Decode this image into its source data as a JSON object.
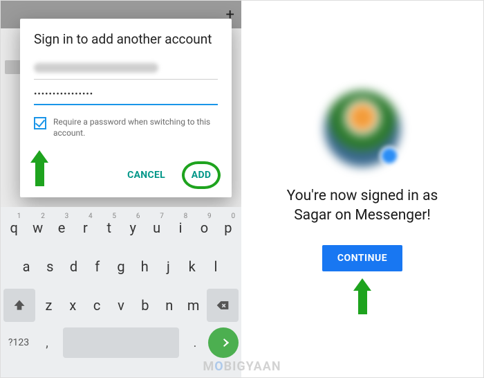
{
  "left": {
    "topbar": {
      "plus": "+"
    },
    "dialog": {
      "title": "Sign in to add another account",
      "password_dots": "••••••••••••••••",
      "checkbox_label": "Require a password when switching to this account.",
      "cancel": "CANCEL",
      "add": "ADD"
    },
    "keyboard": {
      "row1": [
        {
          "k": "q",
          "n": "1"
        },
        {
          "k": "w",
          "n": "2"
        },
        {
          "k": "e",
          "n": "3"
        },
        {
          "k": "r",
          "n": "4"
        },
        {
          "k": "t",
          "n": "5"
        },
        {
          "k": "y",
          "n": "6"
        },
        {
          "k": "u",
          "n": "7"
        },
        {
          "k": "i",
          "n": "8"
        },
        {
          "k": "o",
          "n": "9"
        },
        {
          "k": "p",
          "n": "0"
        }
      ],
      "row2": [
        "a",
        "s",
        "d",
        "f",
        "g",
        "h",
        "j",
        "k",
        "l"
      ],
      "row3": [
        "z",
        "x",
        "c",
        "v",
        "b",
        "n",
        "m"
      ],
      "sym": "?123",
      "comma": ",",
      "period": "."
    }
  },
  "right": {
    "message_line1": "You're now signed in as",
    "message_line2": "Sagar on Messenger!",
    "continue": "CONTINUE"
  },
  "watermark": {
    "pre": "M",
    "mid": "O",
    "post": "BIGYAAN"
  }
}
